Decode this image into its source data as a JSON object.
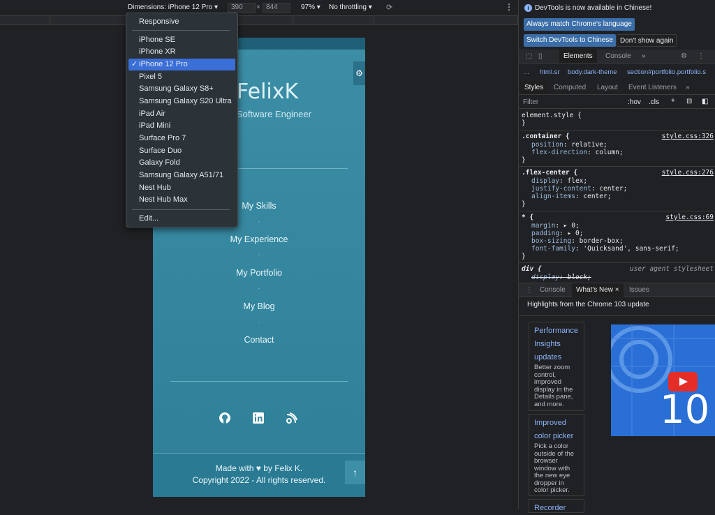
{
  "toolbar": {
    "dimensions_label": "Dimensions: iPhone 12 Pro ▾",
    "width": "390",
    "times": "×",
    "height": "844",
    "zoom": "97% ▾",
    "throttling": "No throttling ▾",
    "rotate_icon": "rotate-icon",
    "more_icon": "more-vertical-icon"
  },
  "device_menu": {
    "items": [
      {
        "label": "Responsive"
      },
      {
        "label": "iPhone SE"
      },
      {
        "label": "iPhone XR"
      },
      {
        "label": "iPhone 12 Pro",
        "selected": true
      },
      {
        "label": "Pixel 5"
      },
      {
        "label": "Samsung Galaxy S8+"
      },
      {
        "label": "Samsung Galaxy S20 Ultra"
      },
      {
        "label": "iPad Air"
      },
      {
        "label": "iPad Mini"
      },
      {
        "label": "Surface Pro 7"
      },
      {
        "label": "Surface Duo"
      },
      {
        "label": "Galaxy Fold"
      },
      {
        "label": "Samsung Galaxy A51/71"
      },
      {
        "label": "Nest Hub"
      },
      {
        "label": "Nest Hub Max"
      },
      {
        "label": "Edit..."
      }
    ],
    "check": "✓"
  },
  "site": {
    "logo": "FelixK",
    "subtitle": "Software Engineer",
    "nav": [
      "My Skills",
      "My Experience",
      "My Portfolio",
      "My Blog",
      "Contact"
    ],
    "dot": "·",
    "social_icons": [
      "github-icon",
      "linkedin-icon",
      "blog-icon"
    ],
    "footer_line1": "Made with ♥ by Felix K.",
    "footer_line2": "Copyright 2022 - All rights reserved.",
    "up_arrow": "↑",
    "accent": "#3c8ea6"
  },
  "devtools": {
    "info": "DevTools is now available in Chinese!",
    "btn_match": "Always match Chrome's language",
    "btn_switch": "Switch DevTools to Chinese",
    "btn_dont": "Don't show again",
    "tabs": [
      "Elements",
      "Console",
      "»"
    ],
    "breadcrumb": [
      "…",
      "html.sr",
      "body.dark-theme",
      "section#portfolio.portfolio.s"
    ],
    "subtabs": [
      "Styles",
      "Computed",
      "Layout",
      "Event Listeners",
      "»"
    ],
    "filter_placeholder": "Filter",
    "filter_hov": ":hov",
    "filter_cls": ".cls",
    "rules": [
      {
        "selector": "element.style {",
        "lines": [],
        "close": "}"
      },
      {
        "selector": ".container {",
        "source": "style.css:326",
        "lines": [
          [
            "position",
            "relative;"
          ],
          [
            "flex-direction",
            "column;"
          ]
        ],
        "close": "}"
      },
      {
        "selector": ".flex-center {",
        "source": "style.css:276",
        "lines": [
          [
            "display",
            "flex;"
          ],
          [
            "justify-content",
            "center;"
          ],
          [
            "align-items",
            "center;"
          ]
        ],
        "close": "}"
      },
      {
        "selector": "* {",
        "source": "style.css:69",
        "lines": [
          [
            "margin",
            "▸ 0;"
          ],
          [
            "padding",
            "▸ 0;"
          ],
          [
            "box-sizing",
            "border-box;"
          ],
          [
            "font-family",
            "'Quicksand', sans-serif;"
          ]
        ],
        "close": "}"
      },
      {
        "selector": "div {",
        "source": "user agent stylesheet",
        "lines": [
          [
            "display",
            "block;"
          ]
        ],
        "close": ""
      }
    ],
    "drawer_tabs": [
      "Console",
      "What's New ×",
      "Issues"
    ],
    "whats_new_title": "Highlights from the Chrome 103 update",
    "cards": [
      {
        "title": "Performance Insights updates",
        "desc": "Better zoom control, improved display in the Details pane, and more."
      },
      {
        "title": "Improved color picker",
        "desc": "Pick a color outside of the browser window with the new eye dropper in color picker."
      },
      {
        "title": "Recorder",
        "desc": ""
      }
    ],
    "promo_number": "10"
  }
}
